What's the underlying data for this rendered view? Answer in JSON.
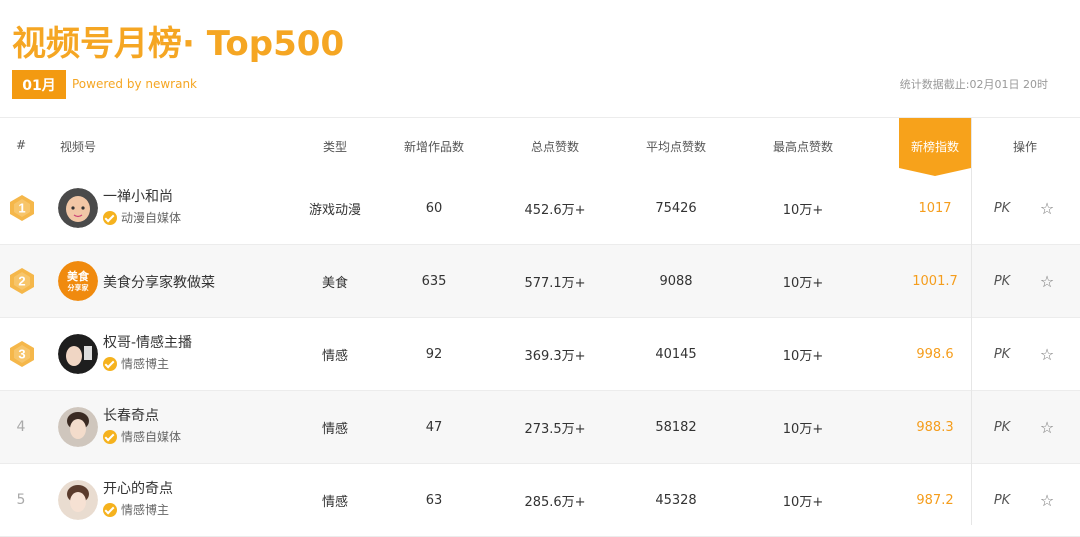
{
  "header": {
    "title": "视频号月榜· Top500",
    "month": "01月",
    "powered_by": "Powered by newrank",
    "stat_time": "统计数据截止:02月01日 20时"
  },
  "columns": {
    "rank": "#",
    "account": "视频号",
    "type": "类型",
    "new_works": "新增作品数",
    "total_likes": "总点赞数",
    "avg_likes": "平均点赞数",
    "max_likes": "最高点赞数",
    "index": "新榜指数",
    "ops": "操作"
  },
  "rows": [
    {
      "rank": "1",
      "name": "一禅小和尚",
      "tag": "动漫自媒体",
      "type": "游戏动漫",
      "new_works": "60",
      "total_likes": "452.6万+",
      "avg_likes": "75426",
      "max_likes": "10万+",
      "index": "1017",
      "pk": "PK",
      "avatar_text": ""
    },
    {
      "rank": "2",
      "name": "美食分享家教做菜",
      "tag": "",
      "type": "美食",
      "new_works": "635",
      "total_likes": "577.1万+",
      "avg_likes": "9088",
      "max_likes": "10万+",
      "index": "1001.7",
      "pk": "PK",
      "avatar_text": "美食分享家"
    },
    {
      "rank": "3",
      "name": "权哥-情感主播",
      "tag": "情感博主",
      "type": "情感",
      "new_works": "92",
      "total_likes": "369.3万+",
      "avg_likes": "40145",
      "max_likes": "10万+",
      "index": "998.6",
      "pk": "PK",
      "avatar_text": ""
    },
    {
      "rank": "4",
      "name": "长春奇点",
      "tag": "情感自媒体",
      "type": "情感",
      "new_works": "47",
      "total_likes": "273.5万+",
      "avg_likes": "58182",
      "max_likes": "10万+",
      "index": "988.3",
      "pk": "PK",
      "avatar_text": ""
    },
    {
      "rank": "5",
      "name": "开心的奇点",
      "tag": "情感博主",
      "type": "情感",
      "new_works": "63",
      "total_likes": "285.6万+",
      "avg_likes": "45328",
      "max_likes": "10万+",
      "index": "987.2",
      "pk": "PK",
      "avatar_text": ""
    }
  ],
  "icons": {
    "medal": "medal-icon",
    "verify": "verified-badge-icon",
    "star": "star-outline-icon"
  },
  "colors": {
    "accent": "#f5a623",
    "index_text": "#f59d1c",
    "medal_gold": "#f5b74a"
  }
}
